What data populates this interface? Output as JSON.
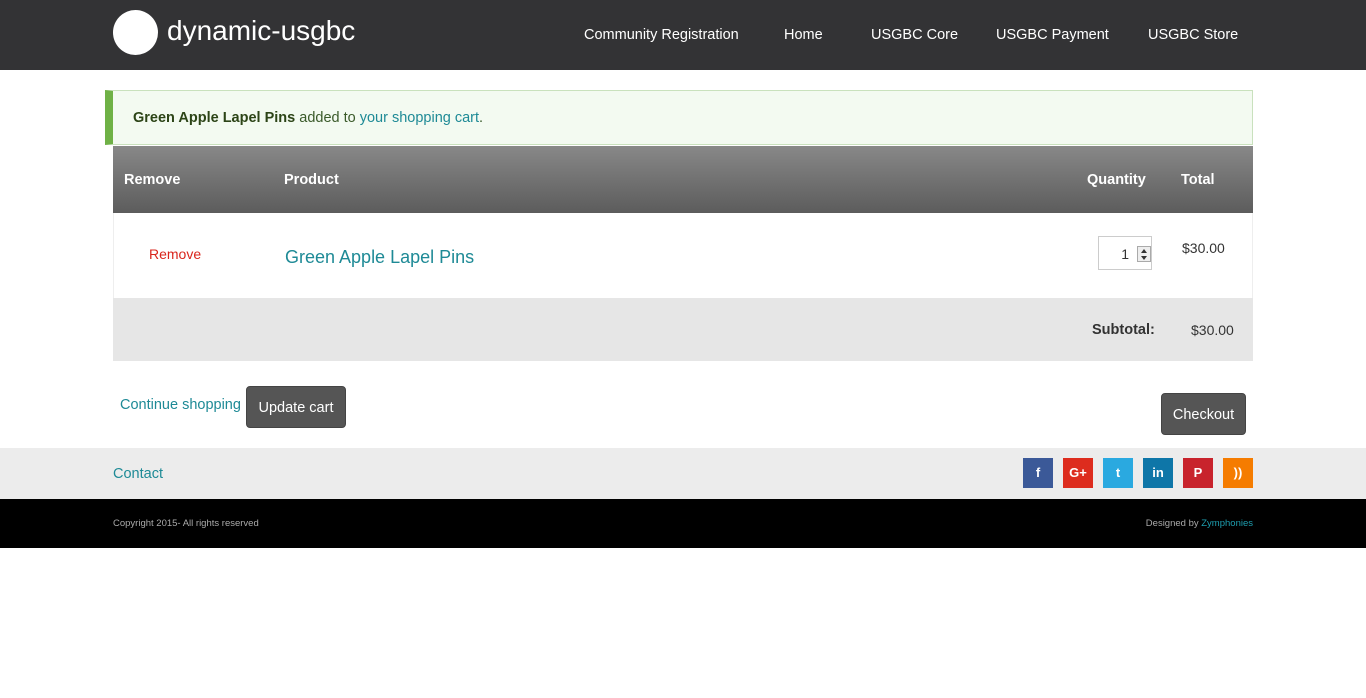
{
  "header": {
    "site_name": "dynamic-usgbc",
    "nav": [
      "Community Registration",
      "Home",
      "USGBC Core",
      "USGBC Payment",
      "USGBC Store"
    ]
  },
  "message": {
    "product": "Green Apple Lapel Pins",
    "middle": " added to ",
    "link": "your shopping cart",
    "end": "."
  },
  "cart": {
    "headers": {
      "remove": "Remove",
      "product": "Product",
      "quantity": "Quantity",
      "total": "Total"
    },
    "items": [
      {
        "remove": "Remove",
        "product": "Green Apple Lapel Pins",
        "quantity": "1",
        "total": "$30.00"
      }
    ],
    "subtotal_label": "Subtotal:",
    "subtotal_value": "$30.00"
  },
  "actions": {
    "continue": "Continue shopping",
    "update": "Update cart",
    "checkout": "Checkout"
  },
  "footer": {
    "contact": "Contact",
    "social": [
      {
        "icon": "facebook-icon",
        "glyph": "f",
        "color": "#3b5998"
      },
      {
        "icon": "google-plus-icon",
        "glyph": "G+",
        "color": "#dd2c1e"
      },
      {
        "icon": "twitter-icon",
        "glyph": "t",
        "color": "#2aa9e0"
      },
      {
        "icon": "linkedin-icon",
        "glyph": "in",
        "color": "#0e76a8"
      },
      {
        "icon": "pinterest-icon",
        "glyph": "P",
        "color": "#c8232c"
      },
      {
        "icon": "rss-icon",
        "glyph": "))",
        "color": "#f57c00"
      }
    ],
    "copyright": "Copyright 2015- All rights reserved",
    "designed_by": "Designed by ",
    "designer": "Zymphonies"
  }
}
